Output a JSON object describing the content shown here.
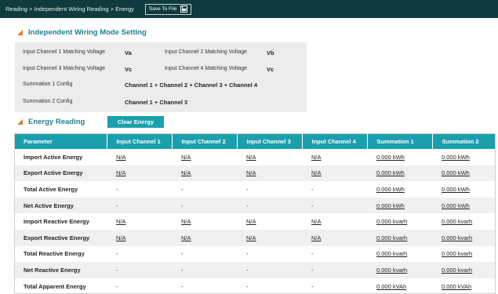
{
  "breadcrumb": "Reading > Independent Wiring Reading > Energy",
  "save_button": "Save To File",
  "mode_section": {
    "title": "Independent Wiring Mode Setting",
    "ch1_label": "Input Channel 1 Matching Voltage",
    "ch1_value": "Va",
    "ch2_label": "Input Channel 2 Matching Voltage",
    "ch2_value": "Vb",
    "ch3_label": "Input Channel 3 Matching Voltage",
    "ch3_value": "Vc",
    "ch4_label": "Input Channel 4 Matching Voltage",
    "ch4_value": "Vc",
    "sum1_label": "Summation 1 Config",
    "sum1_value": "Channel 1 + Channel 2 + Channel 3 + Channel 4",
    "sum2_label": "Summation 2 Config",
    "sum2_value": "Channel 1 + Channel 3"
  },
  "energy_section": {
    "title": "Energy Reading",
    "clear_button": "Clear Energy"
  },
  "table": {
    "headers": [
      "Parameter",
      "Input Channel 1",
      "Input Channel 2",
      "Input Channel 3",
      "Input Channel 4",
      "Summation 1",
      "Summation 2"
    ],
    "rows": [
      [
        "Import Active Energy",
        "N/A",
        "N/A",
        "N/A",
        "N/A",
        "0.000 kWh",
        "0.000 kWh"
      ],
      [
        "Export Active Energy",
        "N/A",
        "N/A",
        "N/A",
        "N/A",
        "0.000 kWh",
        "0.000 kWh"
      ],
      [
        "Total Active Energy",
        "-",
        "-",
        "-",
        "-",
        "0.000 kWh",
        "0.000 kWh"
      ],
      [
        "Net Active Energy",
        "-",
        "-",
        "-",
        "-",
        "0.000 kWh",
        "0.000 kWh"
      ],
      [
        "Import Reactive Energy",
        "N/A",
        "N/A",
        "N/A",
        "N/A",
        "0.000 kvarh",
        "0.000 kvarh"
      ],
      [
        "Export Reactive Energy",
        "N/A",
        "N/A",
        "N/A",
        "N/A",
        "0.000 kvarh",
        "0.000 kvarh"
      ],
      [
        "Total Reactive Energy",
        "-",
        "-",
        "-",
        "-",
        "0.000 kvarh",
        "0.000 kvarh"
      ],
      [
        "Net Reactive Energy",
        "-",
        "-",
        "-",
        "-",
        "0.000 kvarh",
        "0.000 kvarh"
      ],
      [
        "Total Apparent Energy",
        "-",
        "-",
        "-",
        "-",
        "0.000 kVAh",
        "0.000 kVAh"
      ]
    ]
  },
  "icons": {
    "save": "floppy-disk-icon",
    "section_marker": "triangle-marker-icon"
  },
  "colors": {
    "topbar": "#0f3a3e",
    "accent": "#1aa0ad",
    "section_title": "#1f7f92",
    "marker": "#e07b22"
  }
}
